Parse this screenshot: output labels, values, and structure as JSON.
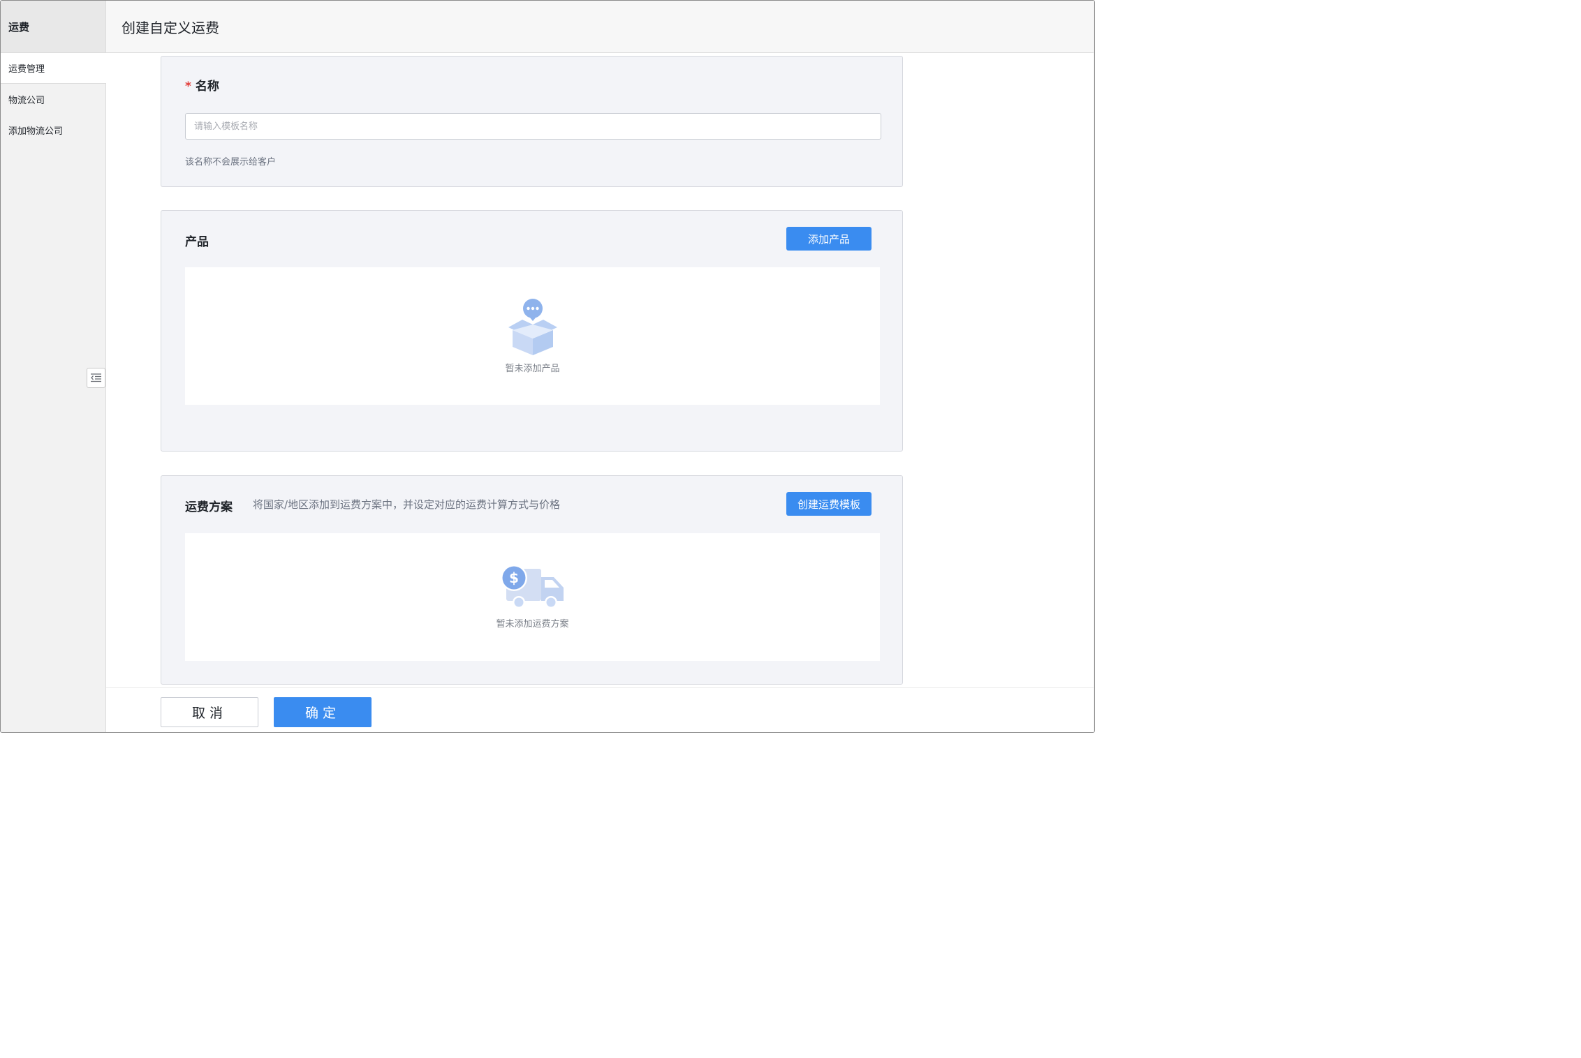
{
  "sidebar": {
    "title": "运费",
    "items": [
      {
        "label": "运费管理",
        "active": true
      },
      {
        "label": "物流公司",
        "active": false
      },
      {
        "label": "添加物流公司",
        "active": false
      }
    ],
    "collapse_icon": "indent-collapse-icon"
  },
  "header": {
    "title": "创建自定义运费"
  },
  "name_section": {
    "required_mark": "*",
    "title": "名称",
    "input_value": "",
    "input_placeholder": "请输入模板名称",
    "help_text": "该名称不会展示给客户"
  },
  "product_section": {
    "title": "产品",
    "add_button_label": "添加产品",
    "empty_icon": "box-chat-icon",
    "empty_text": "暂未添加产品"
  },
  "shipping_section": {
    "title": "运费方案",
    "description": "将国家/地区添加到运费方案中，并设定对应的运费计算方式与价格",
    "create_button_label": "创建运费模板",
    "empty_icon": "truck-dollar-icon",
    "empty_text": "暂未添加运费方案"
  },
  "footer": {
    "cancel_label": "取消",
    "confirm_label": "确定"
  },
  "colors": {
    "primary": "#3a8cf0",
    "required": "#e23c39",
    "card_bg": "#f3f4f8",
    "sidebar_bg": "#f2f2f2",
    "icon_light": "#c9d9f5",
    "icon_mid": "#8fb3ec"
  }
}
